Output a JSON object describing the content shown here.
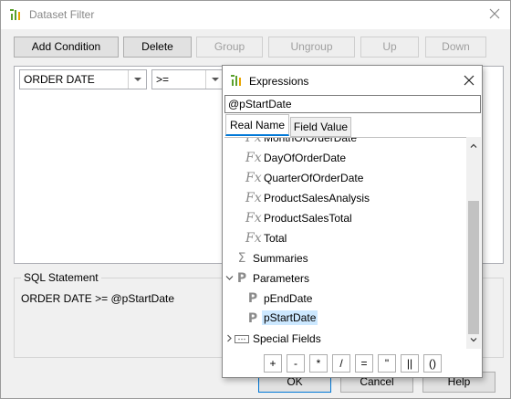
{
  "window": {
    "title": "Dataset Filter",
    "icon": "dataset-filter-icon",
    "close_icon": "close-icon"
  },
  "toolbar": {
    "buttons": [
      {
        "label": "Add Condition",
        "enabled": true
      },
      {
        "label": "Delete",
        "enabled": true
      },
      {
        "label": "Group",
        "enabled": false
      },
      {
        "label": "Ungroup",
        "enabled": false
      },
      {
        "label": "Up",
        "enabled": false
      },
      {
        "label": "Down",
        "enabled": false
      }
    ]
  },
  "condition": {
    "field": "ORDER DATE",
    "operator": ">="
  },
  "sql": {
    "legend": "SQL Statement",
    "text": "ORDER DATE >= @pStartDate"
  },
  "footer": {
    "ok": "OK",
    "cancel": "Cancel",
    "help": "Help"
  },
  "expressions": {
    "title": "Expressions",
    "input_value": "@pStartDate",
    "tabs": [
      {
        "label": "Real Name",
        "active": true
      },
      {
        "label": "Field Value",
        "active": false
      }
    ],
    "tree": [
      {
        "label": "MonthOfOrderDate",
        "icon": "formula-icon",
        "level": 1
      },
      {
        "label": "DayOfOrderDate",
        "icon": "formula-icon",
        "level": 1
      },
      {
        "label": "QuarterOfOrderDate",
        "icon": "formula-icon",
        "level": 1
      },
      {
        "label": "ProductSalesAnalysis",
        "icon": "formula-icon",
        "level": 1
      },
      {
        "label": "ProductSalesTotal",
        "icon": "formula-icon",
        "level": 1
      },
      {
        "label": "Total",
        "icon": "formula-icon",
        "level": 1
      },
      {
        "label": "Summaries",
        "icon": "sigma-icon",
        "level": 0
      },
      {
        "label": "Parameters",
        "icon": "parameter-icon",
        "level": 0,
        "expanded": true
      },
      {
        "label": "pEndDate",
        "icon": "parameter-icon",
        "level": 1
      },
      {
        "label": "pStartDate",
        "icon": "parameter-icon",
        "level": 1,
        "selected": true
      },
      {
        "label": "Special Fields",
        "icon": "special-fields-icon",
        "level": 0,
        "expanded": false
      }
    ],
    "operators": [
      "+",
      "-",
      "*",
      "/",
      "=",
      "\"",
      "||",
      "()"
    ]
  },
  "colors": {
    "accent": "#0078d7",
    "selection": "#cce8ff",
    "dialog_bg": "#f0f0f0"
  }
}
